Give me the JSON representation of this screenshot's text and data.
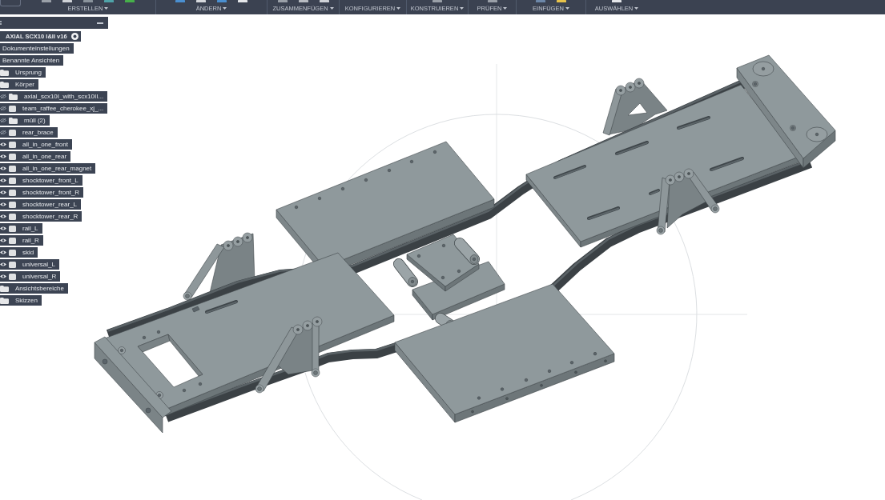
{
  "toolbar": {
    "menus": [
      {
        "label": "ERSTELLEN"
      },
      {
        "label": "ÄNDERN"
      },
      {
        "label": "ZUSAMMENFÜGEN"
      },
      {
        "label": "KONFIGURIEREN"
      },
      {
        "label": "KONSTRUIEREN"
      },
      {
        "label": "PRÜFEN"
      },
      {
        "label": "EINFÜGEN"
      },
      {
        "label": "AUSWÄHLEN"
      }
    ]
  },
  "browser": {
    "tree": [
      {
        "label": "AXIAL SCX10 I&II v16",
        "kind": "component",
        "active": true,
        "children": [
          {
            "label": "Dokumenteinstellungen",
            "kind": "node"
          },
          {
            "label": "Benannte Ansichten",
            "kind": "node"
          },
          {
            "label": "Ursprung",
            "kind": "folder"
          },
          {
            "label": "Körper",
            "kind": "folder",
            "children": [
              {
                "label": "axial_scx10I_with_scx10II...",
                "kind": "folder",
                "visible": false
              },
              {
                "label": "team_raffee_cherokee_xj_...",
                "kind": "body",
                "visible": false
              },
              {
                "label": "müll (2)",
                "kind": "folder",
                "visible": false
              },
              {
                "label": "rear_brace",
                "kind": "body",
                "visible": false
              },
              {
                "label": "all_in_one_front",
                "kind": "body",
                "visible": true
              },
              {
                "label": "all_in_one_rear",
                "kind": "body",
                "visible": true
              },
              {
                "label": "all_in_one_rear_magnet",
                "kind": "body",
                "visible": true
              },
              {
                "label": "shocktower_front_L",
                "kind": "body",
                "visible": true
              },
              {
                "label": "shocktower_front_R",
                "kind": "body",
                "visible": true
              },
              {
                "label": "shocktower_rear_L",
                "kind": "body",
                "visible": true
              },
              {
                "label": "shocktower_rear_R",
                "kind": "body",
                "visible": true
              },
              {
                "label": "rail_L",
                "kind": "body",
                "visible": true
              },
              {
                "label": "rail_R",
                "kind": "body",
                "visible": true
              },
              {
                "label": "skid",
                "kind": "body",
                "visible": true
              },
              {
                "label": "universal_L",
                "kind": "body",
                "visible": true
              },
              {
                "label": "universal_R",
                "kind": "body",
                "visible": true
              }
            ]
          },
          {
            "label": "Ansichtsbereiche",
            "kind": "folder"
          },
          {
            "label": "Skizzen",
            "kind": "folder"
          }
        ]
      }
    ]
  }
}
